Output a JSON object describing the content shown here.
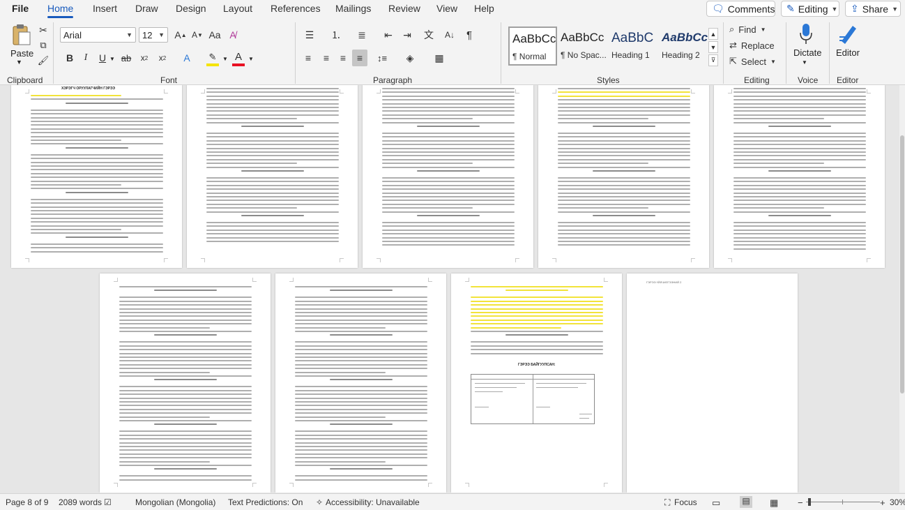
{
  "tabs": [
    "File",
    "Home",
    "Insert",
    "Draw",
    "Design",
    "Layout",
    "References",
    "Mailings",
    "Review",
    "View",
    "Help"
  ],
  "active_tab": "Home",
  "top_actions": {
    "comments": "Comments",
    "editing": "Editing",
    "share": "Share"
  },
  "ribbon": {
    "clipboard": {
      "paste": "Paste",
      "label": "Clipboard"
    },
    "font": {
      "family": "Arial",
      "size": "12",
      "label": "Font",
      "highlight_color": "#f5e400",
      "font_color": "#e81123"
    },
    "paragraph": {
      "label": "Paragraph"
    },
    "styles": {
      "label": "Styles",
      "items": [
        {
          "sample": "AaBbCc",
          "name": "¶ Normal"
        },
        {
          "sample": "AaBbCc",
          "name": "¶ No Spac..."
        },
        {
          "sample": "AaBbC",
          "name": "Heading 1"
        },
        {
          "sample": "AaBbCc",
          "name": "Heading 2"
        }
      ]
    },
    "editing": {
      "label": "Editing",
      "find": "Find",
      "replace": "Replace",
      "select": "Select"
    },
    "voice": {
      "label": "Voice",
      "dictate": "Dictate"
    },
    "editor": {
      "label": "Editor",
      "editor": "Editor"
    }
  },
  "document": {
    "page1_title": "ХЭРЭГЧ ОРУУЛАГЧИЙН ГЭРЭЭ",
    "page4_header": "ГЭРЭЭ ҮЙЛЧИЛГЭЭНИЙ 2",
    "table_title": "ГЭРЭЭ БАЙГУУЛСАН:"
  },
  "status": {
    "page": "Page 8 of 9",
    "words": "2089 words",
    "language": "Mongolian (Mongolia)",
    "predictions": "Text Predictions: On",
    "accessibility": "Accessibility: Unavailable",
    "focus": "Focus",
    "zoom": "30%"
  },
  "colors": {
    "accent": "#185abd",
    "ribbon_bg": "#f3f3f3",
    "canvas": "#e6e6e6"
  }
}
